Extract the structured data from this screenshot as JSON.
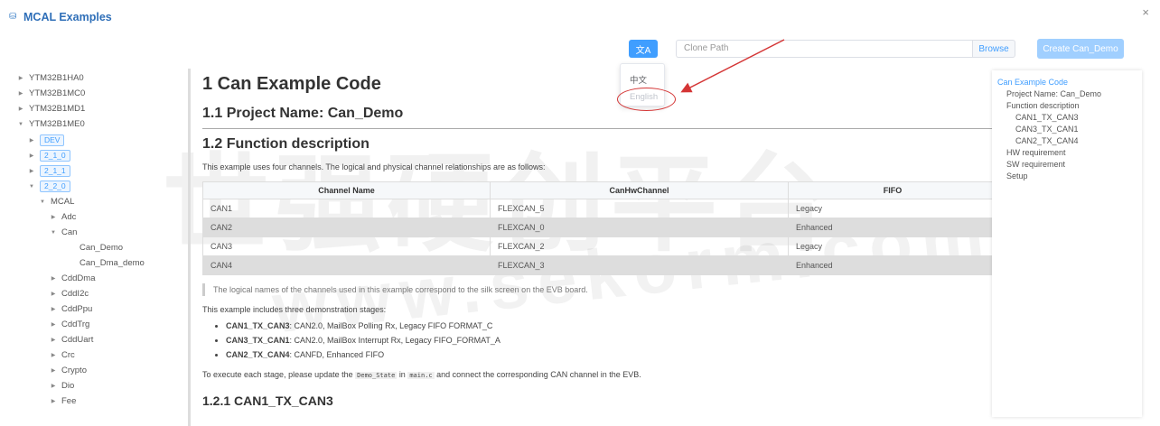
{
  "window": {
    "title": "MCAL Examples",
    "close_label": "×"
  },
  "toolbar": {
    "lang_icon": "translate-icon",
    "lang_glyph": "文A",
    "clone_placeholder": "Clone Path",
    "browse_label": "Browse",
    "create_label": "Create Can_Demo"
  },
  "lang_menu": {
    "zh": "中文",
    "en": "English"
  },
  "tree": [
    {
      "label": "YTM32B1HA0",
      "caret": "▶",
      "tag": false
    },
    {
      "label": "YTM32B1MC0",
      "caret": "▶",
      "tag": false
    },
    {
      "label": "YTM32B1MD1",
      "caret": "▶",
      "tag": false
    },
    {
      "label": "YTM32B1ME0",
      "caret": "▼",
      "tag": false
    },
    {
      "label": "DEV",
      "caret": "▶",
      "tag": true
    },
    {
      "label": "2_1_0",
      "caret": "▶",
      "tag": true
    },
    {
      "label": "2_1_1",
      "caret": "▶",
      "tag": true
    },
    {
      "label": "2_2_0",
      "caret": "▼",
      "tag": true
    },
    {
      "label": "MCAL",
      "caret": "▼",
      "tag": false
    },
    {
      "label": "Adc",
      "caret": "▶",
      "tag": false
    },
    {
      "label": "Can",
      "caret": "▼",
      "tag": false
    },
    {
      "label": "Can_Demo",
      "caret": "",
      "tag": false
    },
    {
      "label": "Can_Dma_demo",
      "caret": "",
      "tag": false
    },
    {
      "label": "CddDma",
      "caret": "▶",
      "tag": false
    },
    {
      "label": "CddI2c",
      "caret": "▶",
      "tag": false
    },
    {
      "label": "CddPpu",
      "caret": "▶",
      "tag": false
    },
    {
      "label": "CddTrg",
      "caret": "▶",
      "tag": false
    },
    {
      "label": "CddUart",
      "caret": "▶",
      "tag": false
    },
    {
      "label": "Crc",
      "caret": "▶",
      "tag": false
    },
    {
      "label": "Crypto",
      "caret": "▶",
      "tag": false
    },
    {
      "label": "Dio",
      "caret": "▶",
      "tag": false
    },
    {
      "label": "Fee",
      "caret": "▶",
      "tag": false
    }
  ],
  "doc": {
    "h1": "1 Can Example Code",
    "h2_project": "1.1 Project Name: Can_Demo",
    "h2_function": "1.2 Function description",
    "intro": "This example uses four channels. The logical and physical channel relationships are as follows:",
    "table": {
      "headers": [
        "Channel Name",
        "CanHwChannel",
        "FIFO"
      ],
      "rows": [
        [
          "CAN1",
          "FLEXCAN_5",
          "Legacy"
        ],
        [
          "CAN2",
          "FLEXCAN_0",
          "Enhanced"
        ],
        [
          "CAN3",
          "FLEXCAN_2",
          "Legacy"
        ],
        [
          "CAN4",
          "FLEXCAN_3",
          "Enhanced"
        ]
      ]
    },
    "quote": "The logical names of the channels used in this example correspond to the silk screen on the EVB board.",
    "stages_intro": "This example includes three demonstration stages:",
    "stages": [
      {
        "name": "CAN1_TX_CAN3",
        "desc": ": CAN2.0, MailBox Polling Rx, Legacy FIFO FORMAT_C"
      },
      {
        "name": "CAN3_TX_CAN1",
        "desc": ": CAN2.0, MailBox Interrupt Rx, Legacy FIFO_FORMAT_A"
      },
      {
        "name": "CAN2_TX_CAN4",
        "desc": ": CANFD, Enhanced FIFO"
      }
    ],
    "execute_a": "To execute each stage, please update the",
    "execute_code1": "Demo_State",
    "execute_b": "in",
    "execute_code2": "main.c",
    "execute_c": "and connect the corresponding CAN channel in the EVB.",
    "h3": "1.2.1 CAN1_TX_CAN3"
  },
  "toc": [
    {
      "label": "Can Example Code",
      "level": 0,
      "active": true
    },
    {
      "label": "Project Name: Can_Demo",
      "level": 1,
      "active": false
    },
    {
      "label": "Function description",
      "level": 1,
      "active": false
    },
    {
      "label": "CAN1_TX_CAN3",
      "level": 2,
      "active": false
    },
    {
      "label": "CAN3_TX_CAN1",
      "level": 2,
      "active": false
    },
    {
      "label": "CAN2_TX_CAN4",
      "level": 2,
      "active": false
    },
    {
      "label": "HW requirement",
      "level": 1,
      "active": false
    },
    {
      "label": "SW requirement",
      "level": 1,
      "active": false
    },
    {
      "label": "Setup",
      "level": 1,
      "active": false
    }
  ],
  "watermark": {
    "cn": "世强硬创平台",
    "url": "www.sekorm.com"
  },
  "colors": {
    "accent": "#409eff",
    "annotation": "#d43535"
  }
}
